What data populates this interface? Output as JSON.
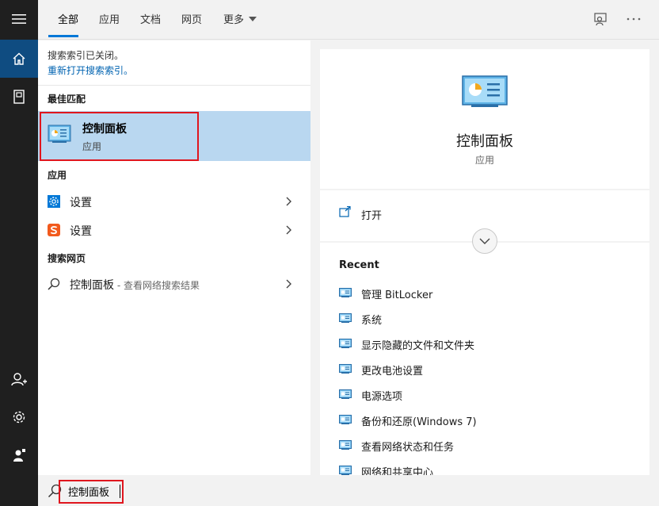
{
  "rail": {
    "items": [
      {
        "name": "hamburger-menu-icon"
      },
      {
        "name": "home-icon"
      },
      {
        "name": "notebook-icon"
      },
      {
        "name": "add-account-icon"
      },
      {
        "name": "settings-gear-icon"
      },
      {
        "name": "feedback-person-icon"
      }
    ],
    "accent": "#0f4c81"
  },
  "tabs": [
    {
      "label": "全部",
      "active": true
    },
    {
      "label": "应用"
    },
    {
      "label": "文档"
    },
    {
      "label": "网页"
    },
    {
      "label": "更多"
    }
  ],
  "top_icons": [
    "feedback-icon",
    "more-options-icon"
  ],
  "notice": {
    "text": "搜索索引已关闭。",
    "link": "重新打开搜索索引。"
  },
  "best_match": {
    "section": "最佳匹配",
    "title": "控制面板",
    "subtitle": "应用"
  },
  "apps": {
    "section": "应用",
    "items": [
      {
        "label": "设置",
        "icon": "settings-app-icon"
      },
      {
        "label": "设置",
        "icon": "sogou-settings-icon"
      }
    ]
  },
  "web": {
    "section": "搜索网页",
    "label": "控制面板",
    "suffix": " - 查看网络搜索结果"
  },
  "detail": {
    "title": "控制面板",
    "subtitle": "应用",
    "open_label": "打开"
  },
  "recent": {
    "title": "Recent",
    "items": [
      "管理 BitLocker",
      "系统",
      "显示隐藏的文件和文件夹",
      "更改电池设置",
      "电源选项",
      "备份和还原(Windows 7)",
      "查看网络状态和任务",
      "网络和共享中心"
    ]
  },
  "search": {
    "value": "控制面板"
  },
  "colors": {
    "highlight": "#b9d7f0",
    "link": "#0063b1",
    "tab_underline": "#0078d7",
    "annotation_red": "#e0161e"
  }
}
